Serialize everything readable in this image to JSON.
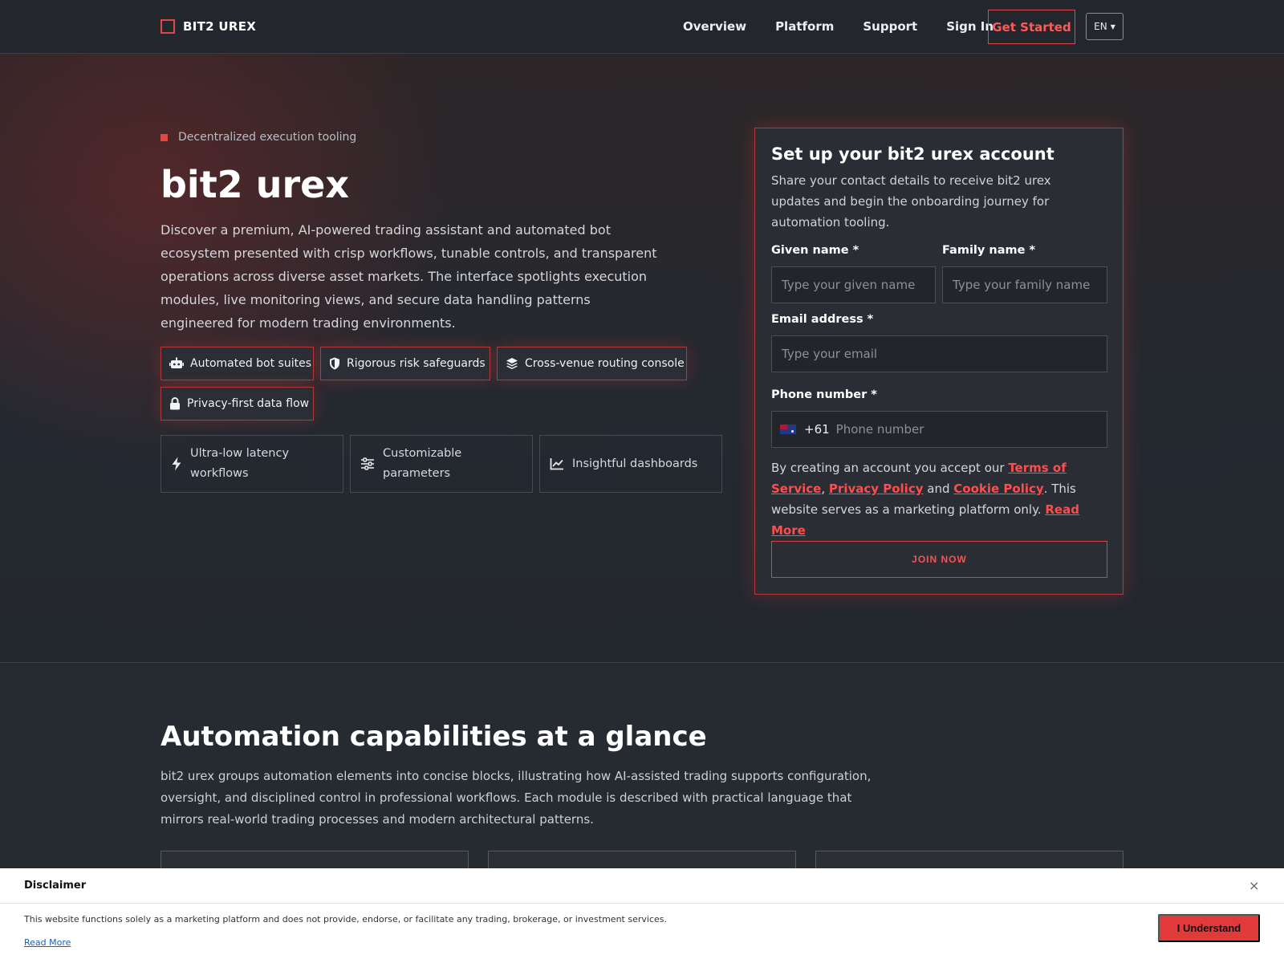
{
  "header": {
    "brand": "BIT2 UREX",
    "nav": [
      "Overview",
      "Platform",
      "Support",
      "Sign In"
    ],
    "cta": "Get Started",
    "language": "EN"
  },
  "hero": {
    "eyebrow": "Decentralized execution tooling",
    "title": "bit2 urex",
    "description": "Discover a premium, AI-powered trading assistant and automated bot ecosystem presented with crisp workflows, tunable controls, and transparent operations across diverse asset markets. The interface spotlights execution modules, live monitoring views, and secure data handling patterns engineered for modern trading environments.",
    "chips": [
      {
        "label": "Automated bot suites",
        "icon": "robot-icon"
      },
      {
        "label": "Rigorous risk safeguards",
        "icon": "shield-icon"
      },
      {
        "label": "Cross-venue routing console",
        "icon": "layers-icon"
      },
      {
        "label": "Privacy-first data flow",
        "icon": "lock-icon"
      }
    ],
    "features": [
      {
        "label": "Ultra-low latency workflows",
        "icon": "bolt-icon"
      },
      {
        "label": "Customizable parameters",
        "icon": "sliders-icon"
      },
      {
        "label": "Insightful dashboards",
        "icon": "chart-line-icon"
      }
    ]
  },
  "form": {
    "title": "Set up your bit2 urex account",
    "subtitle": "Share your contact details to receive bit2 urex updates and begin the onboarding journey for automation tooling.",
    "given_label": "Given name *",
    "given_placeholder": "Type your given name",
    "family_label": "Family name *",
    "family_placeholder": "Type your family name",
    "email_label": "Email address *",
    "email_placeholder": "Type your email",
    "phone_label": "Phone number *",
    "phone_dial": "+61",
    "phone_placeholder": "Phone number",
    "legal_prefix": "By creating an account you accept our ",
    "terms": "Terms of Service",
    "comma": ",",
    "privacy": "Privacy Policy",
    "and": " and ",
    "cookie": "Cookie Policy",
    "legal_suffix": ". This website serves as a marketing platform only. ",
    "read_more": "Read More",
    "submit": "JOIN NOW"
  },
  "capabilities": {
    "title": "Automation capabilities at a glance",
    "description": "bit2 urex groups automation elements into concise blocks, illustrating how AI-assisted trading supports configuration, oversight, and disciplined control in professional workflows. Each module is described with practical language that mirrors real-world trading processes and modern architectural patterns."
  },
  "disclaimer": {
    "title": "Disclaimer",
    "close": "×",
    "text": "This website functions solely as a marketing platform and does not provide, endorse, or facilitate any trading, brokerage, or investment services.",
    "read_more": "Read More",
    "button": "I Understand"
  },
  "colors": {
    "accent": "#e04848",
    "background": "#262a31",
    "link": "#ff4d4d"
  }
}
